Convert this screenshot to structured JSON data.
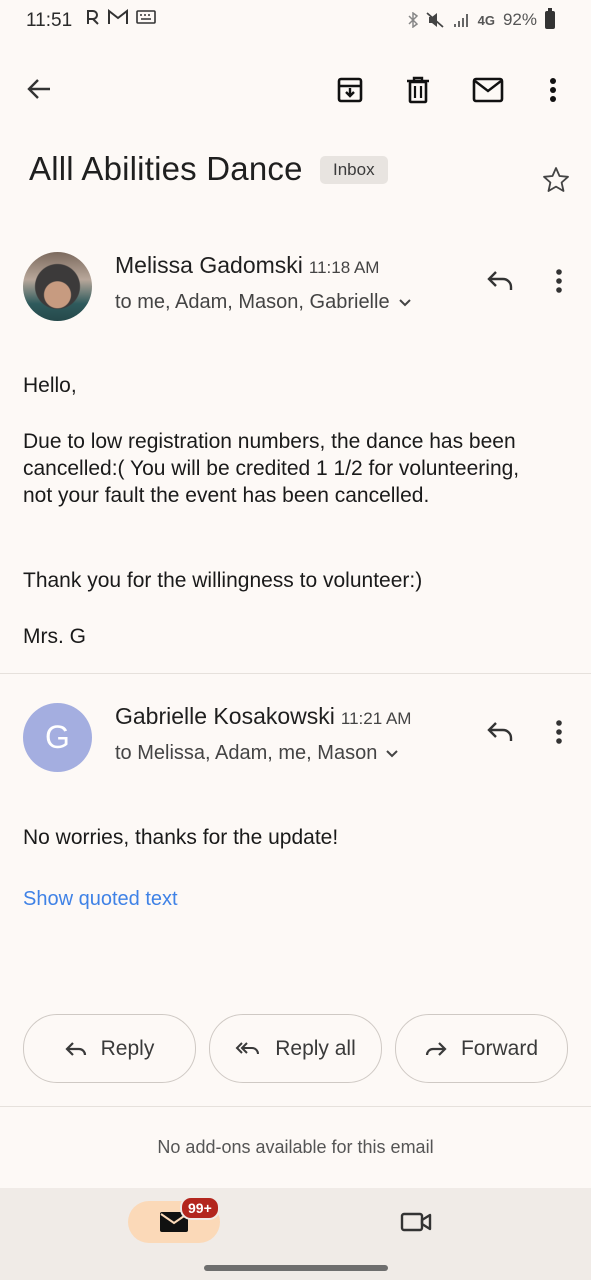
{
  "status_bar": {
    "time": "11:51",
    "network": "4G",
    "battery": "92%"
  },
  "toolbar": {
    "back_icon": "arrow-left-icon",
    "archive_icon": "archive-icon",
    "delete_icon": "trash-icon",
    "mark_unread_icon": "envelope-icon",
    "more_icon": "more-vertical-icon"
  },
  "thread": {
    "subject": "Alll Abilities Dance",
    "label": "Inbox"
  },
  "messages": [
    {
      "sender": "Melissa Gadomski",
      "time": "11:18 AM",
      "recipients": "to me, Adam, Mason, Gabrielle",
      "body": [
        "Hello,",
        "Due to low registration numbers, the dance has been cancelled:(  You will be credited 1 1/2 for volunteering, not your fault the event has been cancelled.",
        "Thank you for the willingness to volunteer:)",
        "Mrs. G"
      ]
    },
    {
      "sender": "Gabrielle Kosakowski",
      "time": "11:21 AM",
      "avatar_letter": "G",
      "recipients": "to Melissa, Adam, me, Mason",
      "body": [
        "No worries, thanks for the update!"
      ],
      "show_quoted": "Show quoted text"
    }
  ],
  "actions": {
    "reply": "Reply",
    "reply_all": "Reply all",
    "forward": "Forward"
  },
  "addons_note": "No add-ons available for this email",
  "bottom_nav": {
    "mail_badge": "99+"
  },
  "colors": {
    "background": "#fdf9f6",
    "link": "#3f82e6",
    "badge": "#b3261e",
    "mail_pill": "#fbd9b8",
    "avatar_g": "#a4aee0"
  }
}
